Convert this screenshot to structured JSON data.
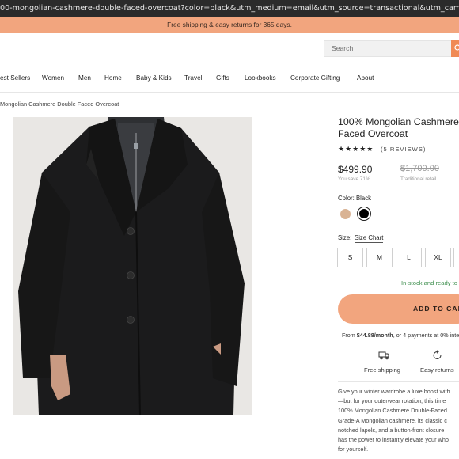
{
  "browser": {
    "url": "00-mongolian-cashmere-double-faced-overcoat?color=black&utm_medium=email&utm_source=transactional&utm_campaign=2023_03_27_orderConfirmation"
  },
  "promo": {
    "text": "Free shipping & easy returns for 365 days."
  },
  "header": {
    "search_placeholder": "Search"
  },
  "nav": {
    "items": [
      "est Sellers",
      "Women",
      "Men",
      "Home",
      "Baby & Kids",
      "Travel",
      "Gifts",
      "Lookbooks",
      "Corporate Gifting",
      "About"
    ]
  },
  "breadcrumb": "Mongolian Cashmere Double Faced Overcoat",
  "product": {
    "title_line1": "100% Mongolian Cashmere",
    "title_line2": "Faced Overcoat",
    "stars": "★★★★★",
    "rating": 5,
    "reviews": "(5 REVIEWS)",
    "price": "$499.90",
    "original_price": "$1,700.00",
    "you_save": "You save 71%",
    "traditional_retail": "Traditional retail",
    "color_label": "Color: Black",
    "colors": [
      {
        "name": "Tan",
        "hex": "#d9b394"
      },
      {
        "name": "Black",
        "hex": "#000000",
        "selected": true
      }
    ],
    "size_label": "Size:",
    "size_chart": "Size Chart",
    "sizes": [
      "S",
      "M",
      "L",
      "XL"
    ],
    "stock": "In-stock and ready to",
    "add_to_cart": "ADD TO CAR",
    "installment_prefix": "From ",
    "installment_amount": "$44.88/month",
    "installment_suffix": ", or 4 payments at 0% inte",
    "features": [
      {
        "label": "Free shipping",
        "icon": "truck-icon"
      },
      {
        "label": "Easy returns",
        "icon": "return-arrow-icon"
      }
    ],
    "description_lines": [
      "Give your winter wardrobe a luxe boost with",
      "—but for your outerwear rotation, this time",
      "100% Mongolian Cashmere Double-Faced",
      "Grade-A Mongolian cashmere, its classic c",
      "notched lapels, and a button-front closure",
      "has the power to instantly elevate your who",
      "for yourself."
    ]
  },
  "colors": {
    "accent": "#f2a57e",
    "stock_green": "#3e8f4e",
    "url_bar": "#2b2b2b"
  }
}
